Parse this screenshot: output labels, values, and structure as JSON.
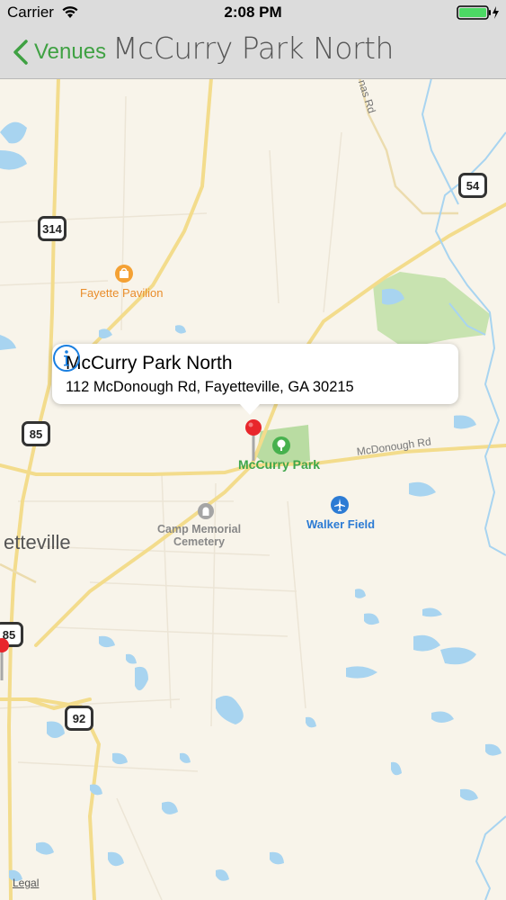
{
  "status_bar": {
    "carrier": "Carrier",
    "time": "2:08 PM"
  },
  "nav": {
    "back_label": "Venues",
    "title": "McCurry Park North"
  },
  "map": {
    "labels": {
      "fayette_pavilion": "Fayette Pavilion",
      "mccurry_park": "McCurry Park",
      "walker_field": "Walker Field",
      "camp_memorial_line1": "Camp Memorial",
      "camp_memorial_line2": "Cemetery",
      "city": "etteville",
      "mcdonough_rd": "McDonough Rd",
      "top_road": "nas Rd"
    },
    "shields": [
      "314",
      "54",
      "85",
      "85",
      "92"
    ],
    "legal": "Legal"
  },
  "callout": {
    "title": "McCurry Park North",
    "address": "112 McDonough Rd, Fayetteville, GA 30215"
  },
  "colors": {
    "accent": "#3fa143",
    "info_blue": "#1a7fe0",
    "pin_red": "#e8262b"
  }
}
